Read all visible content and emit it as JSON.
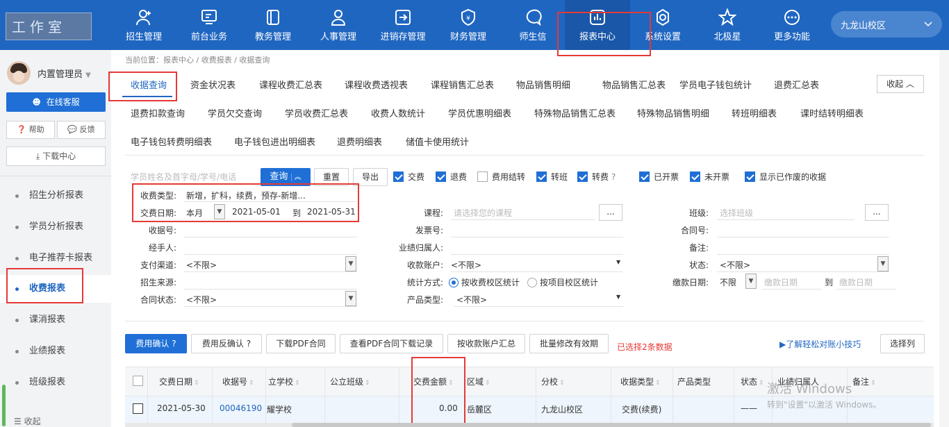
{
  "logo": {
    "text": "工作室"
  },
  "nav": [
    {
      "label": "招生管理",
      "icon": "user-plus-icon"
    },
    {
      "label": "前台业务",
      "icon": "monitor-icon"
    },
    {
      "label": "教务管理",
      "icon": "book-icon"
    },
    {
      "label": "人事管理",
      "icon": "person-icon"
    },
    {
      "label": "进销存管理",
      "icon": "arrow-box-icon"
    },
    {
      "label": "财务管理",
      "icon": "money-shield-icon"
    },
    {
      "label": "师生信",
      "icon": "chat-icon"
    },
    {
      "label": "报表中心",
      "icon": "chart-icon"
    },
    {
      "label": "系统设置",
      "icon": "gear-icon"
    },
    {
      "label": "北极星",
      "icon": "star-icon"
    },
    {
      "label": "更多功能",
      "icon": "more-icon"
    }
  ],
  "campus": "九龙山校区",
  "user": {
    "name": "内置管理员"
  },
  "sidebar": {
    "online_service": "在线客服",
    "help": "帮助",
    "feedback": "反馈",
    "download": "下载中心",
    "items": [
      "招生分析报表",
      "学员分析报表",
      "电子推荐卡报表",
      "收费报表",
      "课消报表",
      "业绩报表",
      "班级报表"
    ],
    "collapse": "收起"
  },
  "breadcrumb": "当前位置：报表中心 / 收费报表 / 收据查询",
  "tabs": {
    "row1": [
      "收据查询",
      "资金状况表",
      "课程收费汇总表",
      "课程收费透视表",
      "课程销售汇总表",
      "物品销售明细",
      "物品销售汇总表",
      "学员电子钱包统计",
      "退费汇总表"
    ],
    "row2": [
      "退费扣款查询",
      "学员欠交查询",
      "学员收费汇总表",
      "收费人数统计",
      "学员优惠明细表",
      "特殊物品销售汇总表",
      "特殊物品销售明细",
      "转班明细表",
      "课时结转明细表"
    ],
    "row3": [
      "电子钱包转费明细表",
      "电子钱包进出明细表",
      "退费明细表",
      "储值卡使用统计"
    ],
    "collapse": "收起"
  },
  "toolbar": {
    "search_placeholder": "学员姓名及首字母/学号/电话",
    "query": "查询",
    "reset": "重置",
    "export": "导出",
    "checks": [
      {
        "label": "交费",
        "checked": true
      },
      {
        "label": "退费",
        "checked": true
      },
      {
        "label": "费用结转",
        "checked": false
      },
      {
        "label": "转班",
        "checked": true
      },
      {
        "label": "转费",
        "checked": true
      },
      {
        "label": "已开票",
        "checked": true
      },
      {
        "label": "未开票",
        "checked": true
      },
      {
        "label": "显示已作废的收据",
        "checked": true
      }
    ]
  },
  "filters": {
    "fee_type_label": "收费类型:",
    "fee_type_value": "新增，扩科，续费，预存-新增...",
    "date_label": "交费日期:",
    "date_range": "本月",
    "date_from": "2021-05-01",
    "date_to_label": "到",
    "date_to": "2021-05-31",
    "course_label": "课程:",
    "course_placeholder": "请选择您的课程",
    "class_label": "班级:",
    "class_placeholder": "选择班级",
    "receipt_no_label": "收据号:",
    "invoice_no_label": "发票号:",
    "contract_no_label": "合同号:",
    "handler_label": "经手人:",
    "perf_owner_label": "业绩归属人:",
    "remark_label": "备注:",
    "pay_channel_label": "支付渠道:",
    "pay_channel_value": "<不限>",
    "account_label": "收款账户:",
    "account_value": "<不限>",
    "status_label": "状态:",
    "status_value": "<不限>",
    "source_label": "招生来源:",
    "stat_mode_label": "统计方式:",
    "stat_mode_a": "按收费校区统计",
    "stat_mode_b": "按项目校区统计",
    "pay_date_label": "缴款日期:",
    "pay_date_value": "不限",
    "pay_date_from_ph": "缴款日期",
    "pay_date_to_label": "到",
    "pay_date_to_ph": "缴款日期",
    "contract_status_label": "合同状态:",
    "contract_status_value": "<不限>",
    "product_type_label": "产品类型:",
    "product_type_value": "<不限>",
    "more": "..."
  },
  "actions": {
    "confirm": "费用确认",
    "unconfirm": "费用反确认",
    "download_pdf": "下载PDF合同",
    "view_pdf_log": "查看PDF合同下载记录",
    "by_account": "按收款账户汇总",
    "batch_edit": "批量修改有效期",
    "selected_info": "已选择2条数据",
    "tip_link": "了解轻松对账小技巧",
    "choose_cols": "选择列"
  },
  "table": {
    "headers": [
      "交费日期",
      "收据号",
      "立学校",
      "公立班级",
      "交费金额",
      "区域",
      "分校",
      "收据类型",
      "产品类型",
      "状态",
      "业绩归属人",
      "备注"
    ],
    "rows": [
      {
        "date": "2021-05-30",
        "receipt": "00046190",
        "school": "耀学校",
        "class": "",
        "amount": "0.00",
        "region": "岳麓区",
        "branch": "九龙山校区",
        "type": "交费(续费)",
        "product": "",
        "status": "——",
        "owner": "",
        "remark": ""
      }
    ]
  },
  "watermark": {
    "line1": "激活 Windows",
    "line2": "转到\"设置\"以激活 Windows。"
  }
}
